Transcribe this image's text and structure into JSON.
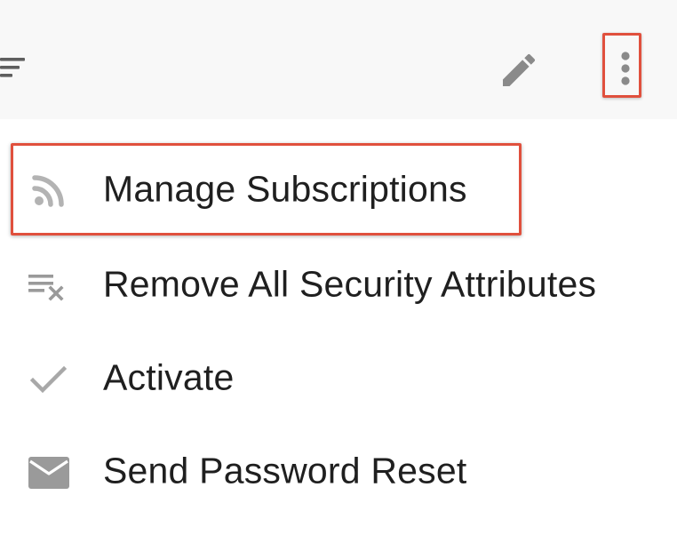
{
  "toolbar": {
    "filter_icon": "filter-list-icon",
    "edit_icon": "pencil-icon",
    "more_icon": "more-vert-icon",
    "icon_color": "#8a8a8a",
    "highlight_color": "#e0503d"
  },
  "menu": {
    "items": [
      {
        "label": "Manage Subscriptions",
        "icon": "rss-feed-icon",
        "highlighted": true
      },
      {
        "label": "Remove All Security Attributes",
        "icon": "clear-all-icon",
        "highlighted": false
      },
      {
        "label": "Activate",
        "icon": "check-icon",
        "highlighted": false
      },
      {
        "label": "Send Password Reset",
        "icon": "envelope-icon",
        "highlighted": false
      }
    ]
  }
}
